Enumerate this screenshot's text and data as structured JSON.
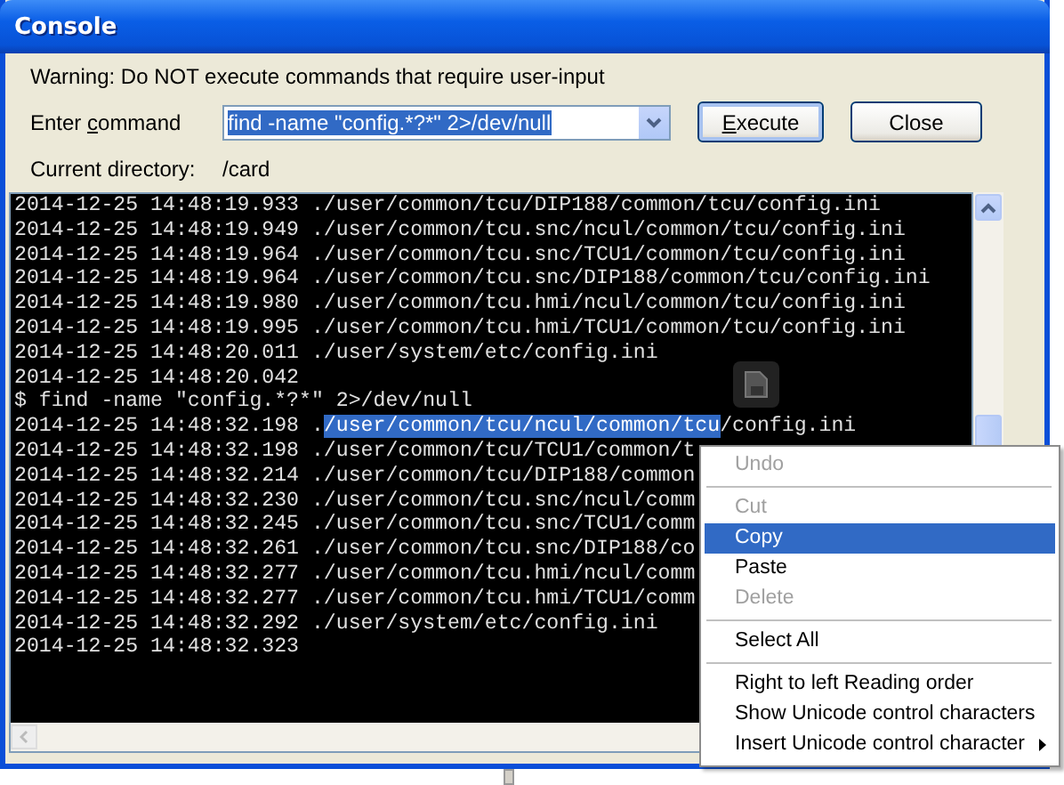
{
  "window": {
    "title": "Console"
  },
  "warning": "Warning: Do NOT execute commands that require user-input",
  "command": {
    "label_parts": [
      {
        "text": "Enter ",
        "underline": false
      },
      {
        "text": "c",
        "underline": true
      },
      {
        "text": "ommand",
        "underline": false
      }
    ],
    "value": "find -name \"config.*?*\" 2>/dev/null",
    "value_selected": true
  },
  "buttons": [
    {
      "label_parts": [
        {
          "text": "E",
          "underline": true
        },
        {
          "text": "xecute",
          "underline": false
        }
      ],
      "default": true
    },
    {
      "label_parts": [
        {
          "text": "Close",
          "underline": false
        }
      ],
      "default": false
    }
  ],
  "directory": {
    "label": "Current directory:",
    "value": "/card"
  },
  "console_lines": [
    {
      "text": "2014-12-25 14:48:19.933 ./user/common/tcu/DIP188/common/tcu/config.ini"
    },
    {
      "text": "2014-12-25 14:48:19.949 ./user/common/tcu.snc/ncul/common/tcu/config.ini"
    },
    {
      "text": "2014-12-25 14:48:19.964 ./user/common/tcu.snc/TCU1/common/tcu/config.ini"
    },
    {
      "text": "2014-12-25 14:48:19.964 ./user/common/tcu.snc/DIP188/common/tcu/config.ini"
    },
    {
      "text": "2014-12-25 14:48:19.980 ./user/common/tcu.hmi/ncul/common/tcu/config.ini"
    },
    {
      "text": "2014-12-25 14:48:19.995 ./user/common/tcu.hmi/TCU1/common/tcu/config.ini"
    },
    {
      "text": "2014-12-25 14:48:20.011 ./user/system/etc/config.ini"
    },
    {
      "text": "2014-12-25 14:48:20.042"
    },
    {
      "text": "$ find -name \"config.*?*\" 2>/dev/null"
    },
    {
      "text": "2014-12-25 14:48:32.198 .",
      "selection": "/user/common/tcu/ncul/common/tcu",
      "after": "/config.ini"
    },
    {
      "text": "2014-12-25 14:48:32.198 ./user/common/tcu/TCU1/common/t"
    },
    {
      "text": "2014-12-25 14:48:32.214 ./user/common/tcu/DIP188/common"
    },
    {
      "text": "2014-12-25 14:48:32.230 ./user/common/tcu.snc/ncul/comm"
    },
    {
      "text": "2014-12-25 14:48:32.245 ./user/common/tcu.snc/TCU1/comm"
    },
    {
      "text": "2014-12-25 14:48:32.261 ./user/common/tcu.snc/DIP188/co"
    },
    {
      "text": "2014-12-25 14:48:32.277 ./user/common/tcu.hmi/ncul/comm"
    },
    {
      "text": "2014-12-25 14:48:32.277 ./user/common/tcu.hmi/TCU1/comm"
    },
    {
      "text": "2014-12-25 14:48:32.292 ./user/system/etc/config.ini"
    },
    {
      "text": "2014-12-25 14:48:32.323"
    }
  ],
  "context_menu": [
    {
      "kind": "item",
      "label": "Undo",
      "disabled": true,
      "selected": false
    },
    {
      "kind": "separator"
    },
    {
      "kind": "item",
      "label": "Cut",
      "disabled": true,
      "selected": false
    },
    {
      "kind": "item",
      "label": "Copy",
      "disabled": false,
      "selected": true
    },
    {
      "kind": "item",
      "label": "Paste",
      "disabled": false,
      "selected": false
    },
    {
      "kind": "item",
      "label": "Delete",
      "disabled": true,
      "selected": false
    },
    {
      "kind": "separator"
    },
    {
      "kind": "item",
      "label": "Select All",
      "disabled": false,
      "selected": false
    },
    {
      "kind": "separator"
    },
    {
      "kind": "item",
      "label": "Right to left Reading order",
      "disabled": false,
      "selected": false
    },
    {
      "kind": "item",
      "label": "Show Unicode control characters",
      "disabled": false,
      "selected": false
    },
    {
      "kind": "submenu",
      "label": "Insert Unicode control character",
      "disabled": false,
      "selected": false
    }
  ]
}
